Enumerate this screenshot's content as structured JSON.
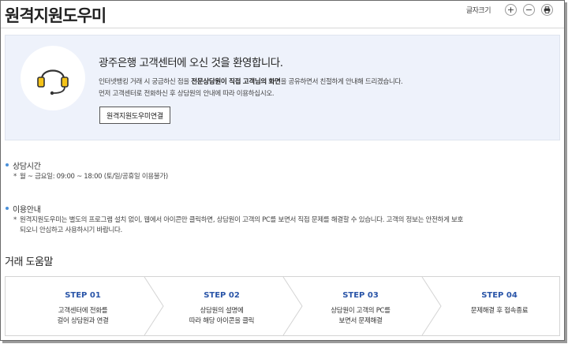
{
  "page": {
    "title": "원격지원도우미"
  },
  "toolbar": {
    "font_size_label": "글자크기",
    "increase_label": "+",
    "decrease_label": "−"
  },
  "welcome": {
    "heading": "광주은행 고객센터에 오신 것을 환영합니다.",
    "line1_prefix": "인터넷뱅킹 거래 시 궁금하신 점을 ",
    "line1_bold": "전문상담원이 직접 고객님의 화면",
    "line1_suffix": "을 공유하면서 친절하게 안내해 드리겠습니다.",
    "line2": "먼저 고객센터로 전화하신 후 상담원의 안내에 따라 이용하십시오.",
    "connect_button": "원격지원도우미연결"
  },
  "hours": {
    "title": "상담시간",
    "star": "*",
    "text": "월 ~ 금요일: 09:00 ~ 18:00 (토/일/공휴일 이용불가)"
  },
  "usage": {
    "title": "이용안내",
    "star": "*",
    "text_line1": "원격지원도우미는 별도의 프로그램 설치 없이, 웹에서 아이콘만 클릭하면, 상담원이 고객의 PC를 보면서 직접 문제를 해결할 수 있습니다. 고객의 정보는 안전하게 보호",
    "text_line2": "되오니 안심하고 사용하시기 바랍니다."
  },
  "help": {
    "title": "거래 도움말",
    "steps": [
      {
        "title": "STEP 01",
        "line1": "고객센터에 전화를",
        "line2": "걸어 상담원과 연결"
      },
      {
        "title": "STEP 02",
        "line1": "상담원의 설명에",
        "line2": "따라 해당 아이콘을 클릭"
      },
      {
        "title": "STEP 03",
        "line1": "상담원이 고객의 PC를",
        "line2": "보면서 문제해결"
      },
      {
        "title": "STEP 04",
        "line1": "문제해결 후 접속종료",
        "line2": ""
      }
    ]
  },
  "colors": {
    "accent": "#2a55a8",
    "bullet": "#4a90d9",
    "welcome_bg": "#eef2fb",
    "headset_yellow": "#f5c318"
  },
  "icons": {
    "headset": "headset-icon",
    "print": "print-icon"
  }
}
